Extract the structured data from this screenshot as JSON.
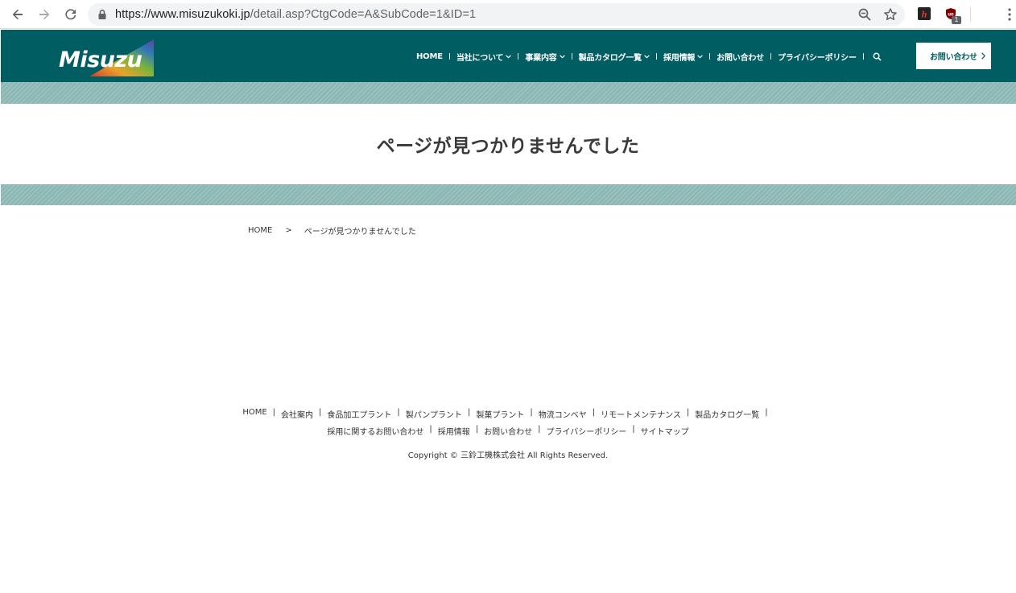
{
  "browser": {
    "url_host": "https://www.misuzukoki.jp",
    "url_path": "/detail.asp?CtgCode=A&SubCode=1&ID=1",
    "extension_badge": "1"
  },
  "header": {
    "logo_text": "Misuzu",
    "nav": [
      {
        "label": "HOME",
        "has_dropdown": false
      },
      {
        "label": "当社について",
        "has_dropdown": true
      },
      {
        "label": "事業内容",
        "has_dropdown": true
      },
      {
        "label": "製品カタログ一覧",
        "has_dropdown": true
      },
      {
        "label": "採用情報",
        "has_dropdown": true
      },
      {
        "label": "お問い合わせ",
        "has_dropdown": false
      },
      {
        "label": "プライバシーポリシー",
        "has_dropdown": false
      }
    ],
    "contact_button": "お問い合わせ"
  },
  "main": {
    "title": "ページが見つかりませんでした",
    "breadcrumb": {
      "home": "HOME",
      "separator": ">",
      "current": "ページが見つかりませんでした"
    }
  },
  "footer": {
    "nav_row1": [
      "HOME",
      "会社案内",
      "食品加工プラント",
      "製パンプラント",
      "製菓プラント",
      "物流コンベヤ",
      "リモートメンテナンス",
      "製品カタログ一覧"
    ],
    "nav_row2": [
      "採用に関するお問い合わせ",
      "採用情報",
      "お問い合わせ",
      "プライバシーポリシー",
      "サイトマップ"
    ],
    "copyright": "Copyright © 三鈴工機株式会社 All Rights Reserved."
  },
  "colors": {
    "brand": "#005e62",
    "band": "#8bb7b4",
    "text": "#333333"
  }
}
